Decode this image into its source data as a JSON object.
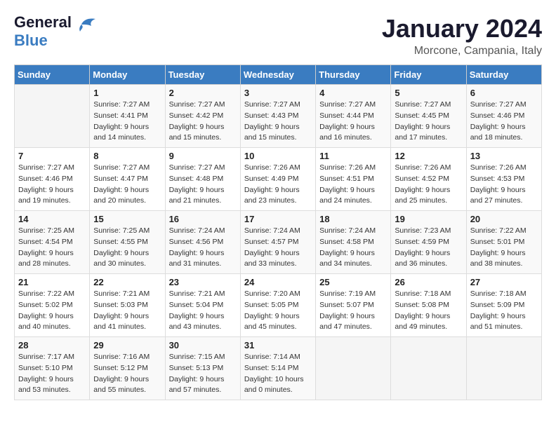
{
  "header": {
    "logo_line1": "General",
    "logo_line2": "Blue",
    "month_title": "January 2024",
    "location": "Morcone, Campania, Italy"
  },
  "days_of_week": [
    "Sunday",
    "Monday",
    "Tuesday",
    "Wednesday",
    "Thursday",
    "Friday",
    "Saturday"
  ],
  "weeks": [
    [
      {
        "day": "",
        "info": ""
      },
      {
        "day": "1",
        "info": "Sunrise: 7:27 AM\nSunset: 4:41 PM\nDaylight: 9 hours\nand 14 minutes."
      },
      {
        "day": "2",
        "info": "Sunrise: 7:27 AM\nSunset: 4:42 PM\nDaylight: 9 hours\nand 15 minutes."
      },
      {
        "day": "3",
        "info": "Sunrise: 7:27 AM\nSunset: 4:43 PM\nDaylight: 9 hours\nand 15 minutes."
      },
      {
        "day": "4",
        "info": "Sunrise: 7:27 AM\nSunset: 4:44 PM\nDaylight: 9 hours\nand 16 minutes."
      },
      {
        "day": "5",
        "info": "Sunrise: 7:27 AM\nSunset: 4:45 PM\nDaylight: 9 hours\nand 17 minutes."
      },
      {
        "day": "6",
        "info": "Sunrise: 7:27 AM\nSunset: 4:46 PM\nDaylight: 9 hours\nand 18 minutes."
      }
    ],
    [
      {
        "day": "7",
        "info": "Sunrise: 7:27 AM\nSunset: 4:46 PM\nDaylight: 9 hours\nand 19 minutes."
      },
      {
        "day": "8",
        "info": "Sunrise: 7:27 AM\nSunset: 4:47 PM\nDaylight: 9 hours\nand 20 minutes."
      },
      {
        "day": "9",
        "info": "Sunrise: 7:27 AM\nSunset: 4:48 PM\nDaylight: 9 hours\nand 21 minutes."
      },
      {
        "day": "10",
        "info": "Sunrise: 7:26 AM\nSunset: 4:49 PM\nDaylight: 9 hours\nand 23 minutes."
      },
      {
        "day": "11",
        "info": "Sunrise: 7:26 AM\nSunset: 4:51 PM\nDaylight: 9 hours\nand 24 minutes."
      },
      {
        "day": "12",
        "info": "Sunrise: 7:26 AM\nSunset: 4:52 PM\nDaylight: 9 hours\nand 25 minutes."
      },
      {
        "day": "13",
        "info": "Sunrise: 7:26 AM\nSunset: 4:53 PM\nDaylight: 9 hours\nand 27 minutes."
      }
    ],
    [
      {
        "day": "14",
        "info": "Sunrise: 7:25 AM\nSunset: 4:54 PM\nDaylight: 9 hours\nand 28 minutes."
      },
      {
        "day": "15",
        "info": "Sunrise: 7:25 AM\nSunset: 4:55 PM\nDaylight: 9 hours\nand 30 minutes."
      },
      {
        "day": "16",
        "info": "Sunrise: 7:24 AM\nSunset: 4:56 PM\nDaylight: 9 hours\nand 31 minutes."
      },
      {
        "day": "17",
        "info": "Sunrise: 7:24 AM\nSunset: 4:57 PM\nDaylight: 9 hours\nand 33 minutes."
      },
      {
        "day": "18",
        "info": "Sunrise: 7:24 AM\nSunset: 4:58 PM\nDaylight: 9 hours\nand 34 minutes."
      },
      {
        "day": "19",
        "info": "Sunrise: 7:23 AM\nSunset: 4:59 PM\nDaylight: 9 hours\nand 36 minutes."
      },
      {
        "day": "20",
        "info": "Sunrise: 7:22 AM\nSunset: 5:01 PM\nDaylight: 9 hours\nand 38 minutes."
      }
    ],
    [
      {
        "day": "21",
        "info": "Sunrise: 7:22 AM\nSunset: 5:02 PM\nDaylight: 9 hours\nand 40 minutes."
      },
      {
        "day": "22",
        "info": "Sunrise: 7:21 AM\nSunset: 5:03 PM\nDaylight: 9 hours\nand 41 minutes."
      },
      {
        "day": "23",
        "info": "Sunrise: 7:21 AM\nSunset: 5:04 PM\nDaylight: 9 hours\nand 43 minutes."
      },
      {
        "day": "24",
        "info": "Sunrise: 7:20 AM\nSunset: 5:05 PM\nDaylight: 9 hours\nand 45 minutes."
      },
      {
        "day": "25",
        "info": "Sunrise: 7:19 AM\nSunset: 5:07 PM\nDaylight: 9 hours\nand 47 minutes."
      },
      {
        "day": "26",
        "info": "Sunrise: 7:18 AM\nSunset: 5:08 PM\nDaylight: 9 hours\nand 49 minutes."
      },
      {
        "day": "27",
        "info": "Sunrise: 7:18 AM\nSunset: 5:09 PM\nDaylight: 9 hours\nand 51 minutes."
      }
    ],
    [
      {
        "day": "28",
        "info": "Sunrise: 7:17 AM\nSunset: 5:10 PM\nDaylight: 9 hours\nand 53 minutes."
      },
      {
        "day": "29",
        "info": "Sunrise: 7:16 AM\nSunset: 5:12 PM\nDaylight: 9 hours\nand 55 minutes."
      },
      {
        "day": "30",
        "info": "Sunrise: 7:15 AM\nSunset: 5:13 PM\nDaylight: 9 hours\nand 57 minutes."
      },
      {
        "day": "31",
        "info": "Sunrise: 7:14 AM\nSunset: 5:14 PM\nDaylight: 10 hours\nand 0 minutes."
      },
      {
        "day": "",
        "info": ""
      },
      {
        "day": "",
        "info": ""
      },
      {
        "day": "",
        "info": ""
      }
    ]
  ]
}
